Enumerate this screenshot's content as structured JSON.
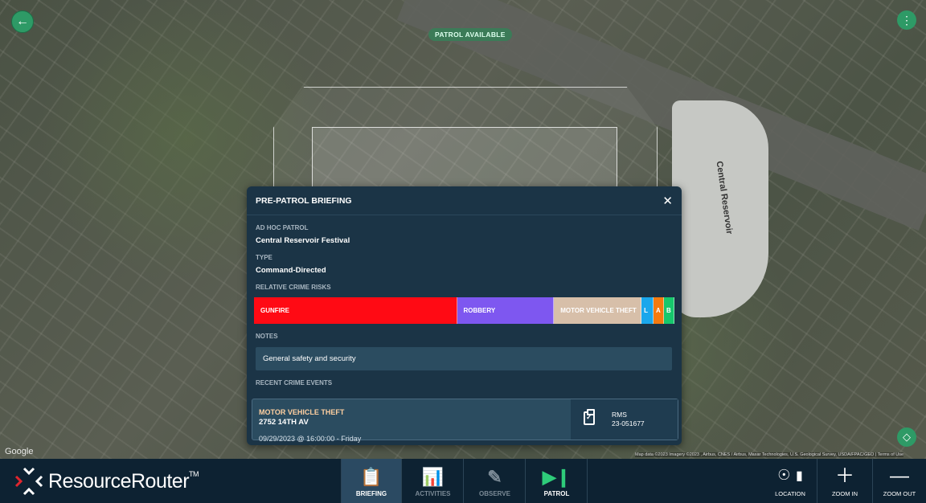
{
  "map": {
    "patrol_tag": "PATROL AVAILABLE",
    "reservoir_label": "Central Reservoir",
    "google_label": "Google",
    "attribution": "Map data ©2023 Imagery ©2023 , Airbus, CNES / Airbus, Maxar Technologies, U.S. Geological Survey, USDA/FPAC/GEO | Terms of Use"
  },
  "modal": {
    "title": "PRE-PATROL BRIEFING",
    "patrol_label": "AD HOC PATROL",
    "patrol_value": "Central Reservoir Festival",
    "type_label": "TYPE",
    "type_value": "Command-Directed",
    "risks_label": "RELATIVE CRIME RISKS",
    "risks": [
      {
        "label": "GUNFIRE",
        "share": 0.483,
        "color": "#ff0a14"
      },
      {
        "label": "ROBBERY",
        "share": 0.231,
        "color": "#7e57f0"
      },
      {
        "label": "MOTOR VEHICLE THEFT",
        "share": 0.208,
        "color": "#d7bfa9"
      },
      {
        "label": "L",
        "share": 0.029,
        "color": "#1aa7ec"
      },
      {
        "label": "A",
        "share": 0.025,
        "color": "#f47a0f"
      },
      {
        "label": "B",
        "share": 0.024,
        "color": "#17c76c"
      }
    ],
    "notes_label": "NOTES",
    "notes_value": "General safety and security",
    "events_label": "RECENT CRIME EVENTS",
    "event": {
      "type": "MOTOR VEHICLE THEFT",
      "address": "2752 14TH AV",
      "date": "09/29/2023 @ 16:00:00 - Friday",
      "source": "RMS",
      "number": "23-051677"
    }
  },
  "bottom": {
    "logo_text": "ResourceRouter",
    "logo_tm": "TM",
    "tabs": [
      {
        "label": "BRIEFING"
      },
      {
        "label": "ACTIVITIES"
      },
      {
        "label": "OBSERVE"
      },
      {
        "label": "PATROL"
      }
    ],
    "tools": [
      {
        "label": "LOCATION"
      },
      {
        "label": "ZOOM IN"
      },
      {
        "label": "ZOOM OUT"
      }
    ]
  },
  "colors": {
    "accent_green": "#2e9a66",
    "panel_bg": "#1b3446",
    "nav_bg": "#0d2232",
    "event_type": "#ffcfa0"
  },
  "icons": [
    "back-arrow-icon",
    "more-vertical-icon",
    "recenter-icon",
    "close-icon",
    "clipboard-check-icon",
    "briefing-icon",
    "activities-icon",
    "observe-pencil-icon",
    "patrol-play-icon",
    "location-pointer-icon",
    "signal-bars-icon",
    "plus-icon",
    "minus-icon"
  ]
}
